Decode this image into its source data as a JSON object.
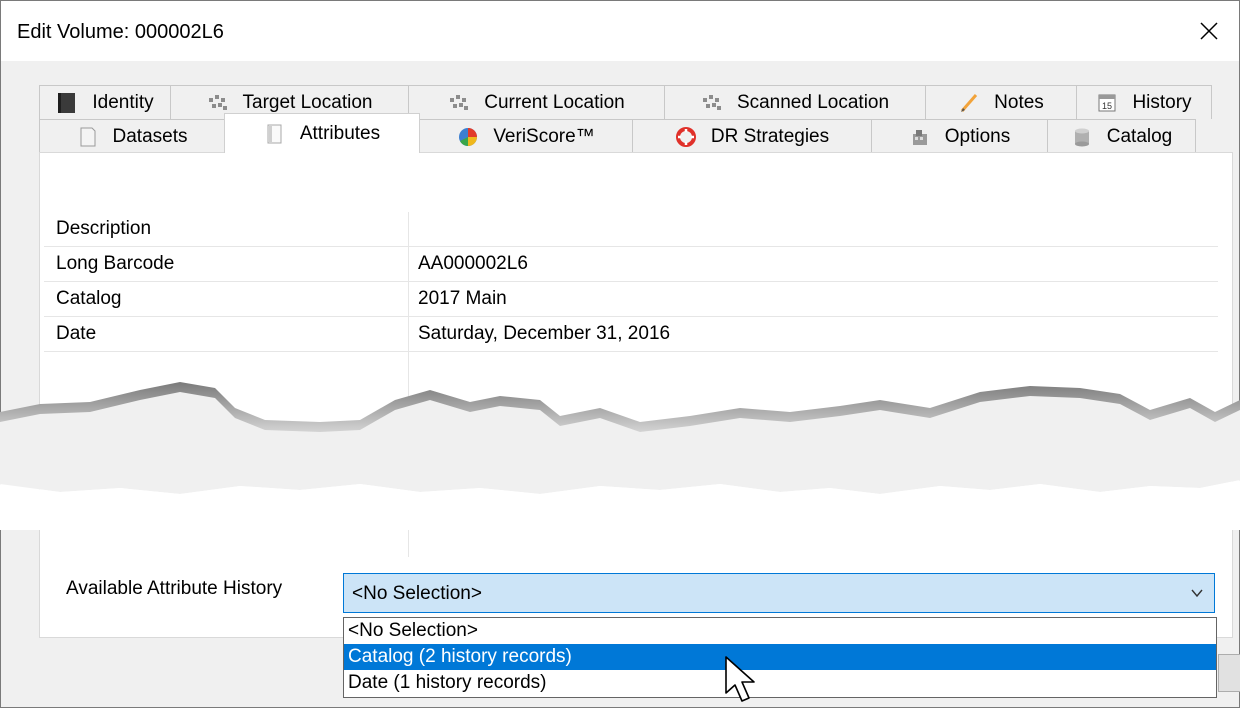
{
  "window": {
    "title": "Edit Volume: 000002L6",
    "close_glyph": "✕"
  },
  "tabs": {
    "back_row": [
      {
        "label": "Identity",
        "icon": "identity-book-icon"
      },
      {
        "label": "Target Location",
        "icon": "location-grid-icon"
      },
      {
        "label": "Current Location",
        "icon": "location-grid-icon"
      },
      {
        "label": "Scanned Location",
        "icon": "location-grid-icon"
      },
      {
        "label": "Notes",
        "icon": "pencil-icon"
      },
      {
        "label": "History",
        "icon": "calendar-icon"
      }
    ],
    "front_row": [
      {
        "label": "Datasets",
        "icon": "document-icon"
      },
      {
        "label": "Attributes",
        "icon": "attributes-page-icon",
        "active": true
      },
      {
        "label": "VeriScore™",
        "icon": "veriscore-pie-icon"
      },
      {
        "label": "DR Strategies",
        "icon": "lifebuoy-icon"
      },
      {
        "label": "Options",
        "icon": "options-icon"
      },
      {
        "label": "Catalog",
        "icon": "database-icon"
      }
    ]
  },
  "attributes": [
    {
      "name": "Description",
      "value": ""
    },
    {
      "name": "Long Barcode",
      "value": "AA000002L6"
    },
    {
      "name": "Catalog",
      "value": "2017 Main"
    },
    {
      "name": "Date",
      "value": "Saturday, December 31, 2016"
    }
  ],
  "history": {
    "label": "Available Attribute History",
    "selected": "<No Selection>",
    "options": [
      {
        "label": "<No Selection>",
        "highlighted": false
      },
      {
        "label": "Catalog (2 history records)",
        "highlighted": true
      },
      {
        "label": "Date (1 history records)",
        "highlighted": false
      }
    ]
  },
  "colors": {
    "accent": "#0078d7",
    "combo_bg": "#cce4f7",
    "tab_bg": "#f0f0f0"
  }
}
